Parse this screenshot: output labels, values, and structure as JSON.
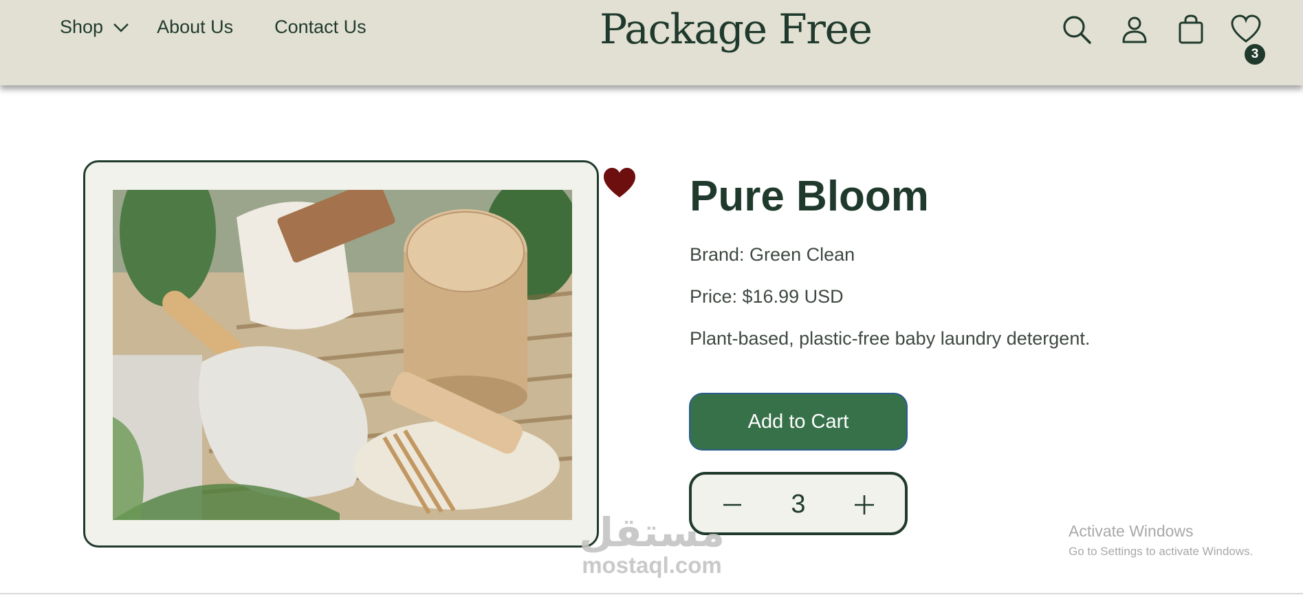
{
  "header": {
    "nav": {
      "shop_label": "Shop",
      "about_label": "About Us",
      "contact_label": "Contact Us"
    },
    "logo_text": "Package Free",
    "icons": [
      "search-icon",
      "user-icon",
      "cart-icon",
      "wishlist-heart-icon"
    ],
    "wishlist_count": "3"
  },
  "product": {
    "title": "Pure Bloom",
    "brand_line": "Brand: Green Clean",
    "price_line": "Price: $16.99 USD",
    "description": "Plant-based, plastic-free baby laundry detergent.",
    "add_to_cart_label": "Add to Cart",
    "quantity": "3",
    "favorite": true
  },
  "overlay": {
    "watermark_arabic": "مستقل",
    "watermark_site": "mostaql.com",
    "activate_title": "Activate Windows",
    "activate_subtitle": "Go to Settings to activate Windows."
  },
  "colors": {
    "header_bg": "#e1e0d3",
    "brand_green": "#1f3a2c",
    "button_green": "#37714a",
    "heart_red": "#6e0f0f",
    "card_bg": "#f2f2ec"
  }
}
